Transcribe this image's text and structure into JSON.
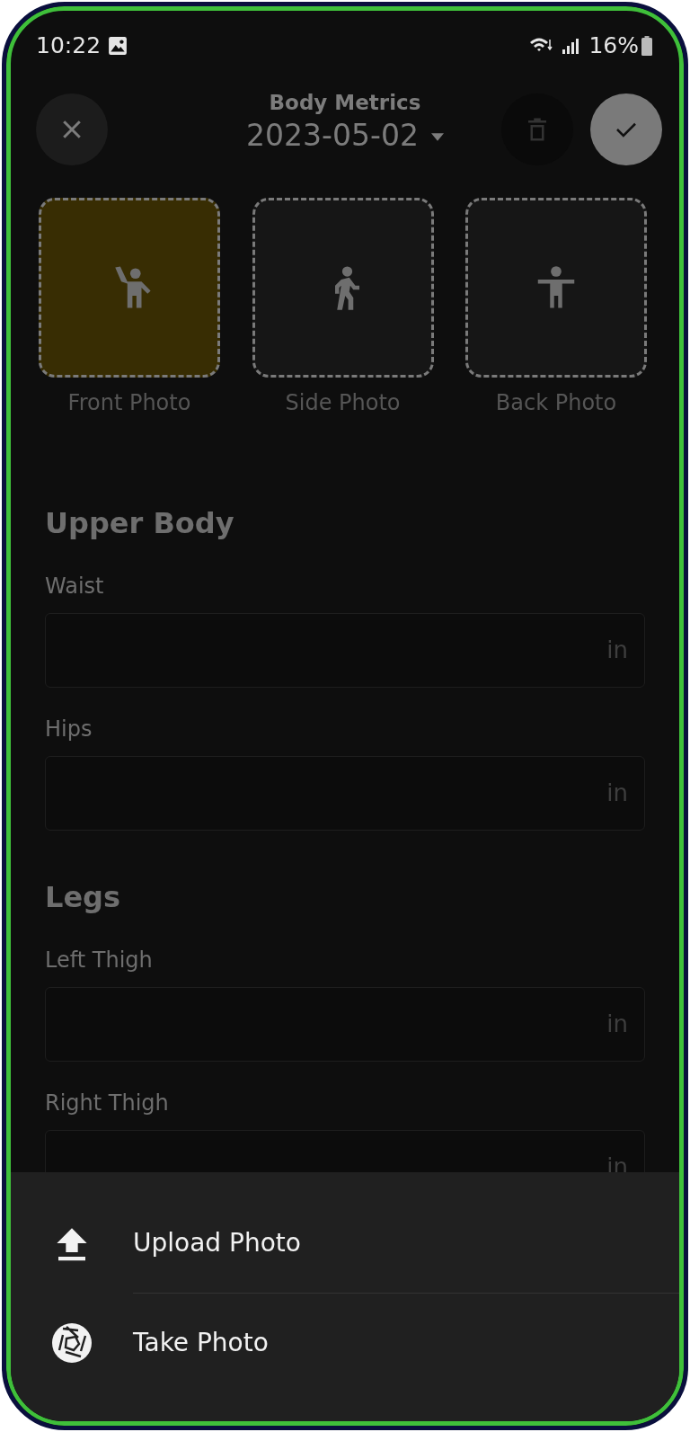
{
  "status_bar": {
    "time": "10:22",
    "battery": "16%"
  },
  "header": {
    "title": "Body Metrics",
    "date": "2023-05-02"
  },
  "photos": [
    {
      "label": "Front Photo",
      "kind": "wave",
      "selected": true
    },
    {
      "label": "Side Photo",
      "kind": "walk",
      "selected": false
    },
    {
      "label": "Back Photo",
      "kind": "arms",
      "selected": false
    }
  ],
  "sections": [
    {
      "title": "Upper Body",
      "fields": [
        {
          "label": "Waist",
          "unit": "in"
        },
        {
          "label": "Hips",
          "unit": "in"
        }
      ]
    },
    {
      "title": "Legs",
      "fields": [
        {
          "label": "Left Thigh",
          "unit": "in"
        },
        {
          "label": "Right Thigh",
          "unit": "in"
        }
      ]
    }
  ],
  "sheet": {
    "items": [
      {
        "kind": "upload",
        "label": "Upload Photo"
      },
      {
        "kind": "camera",
        "label": "Take Photo"
      }
    ]
  }
}
